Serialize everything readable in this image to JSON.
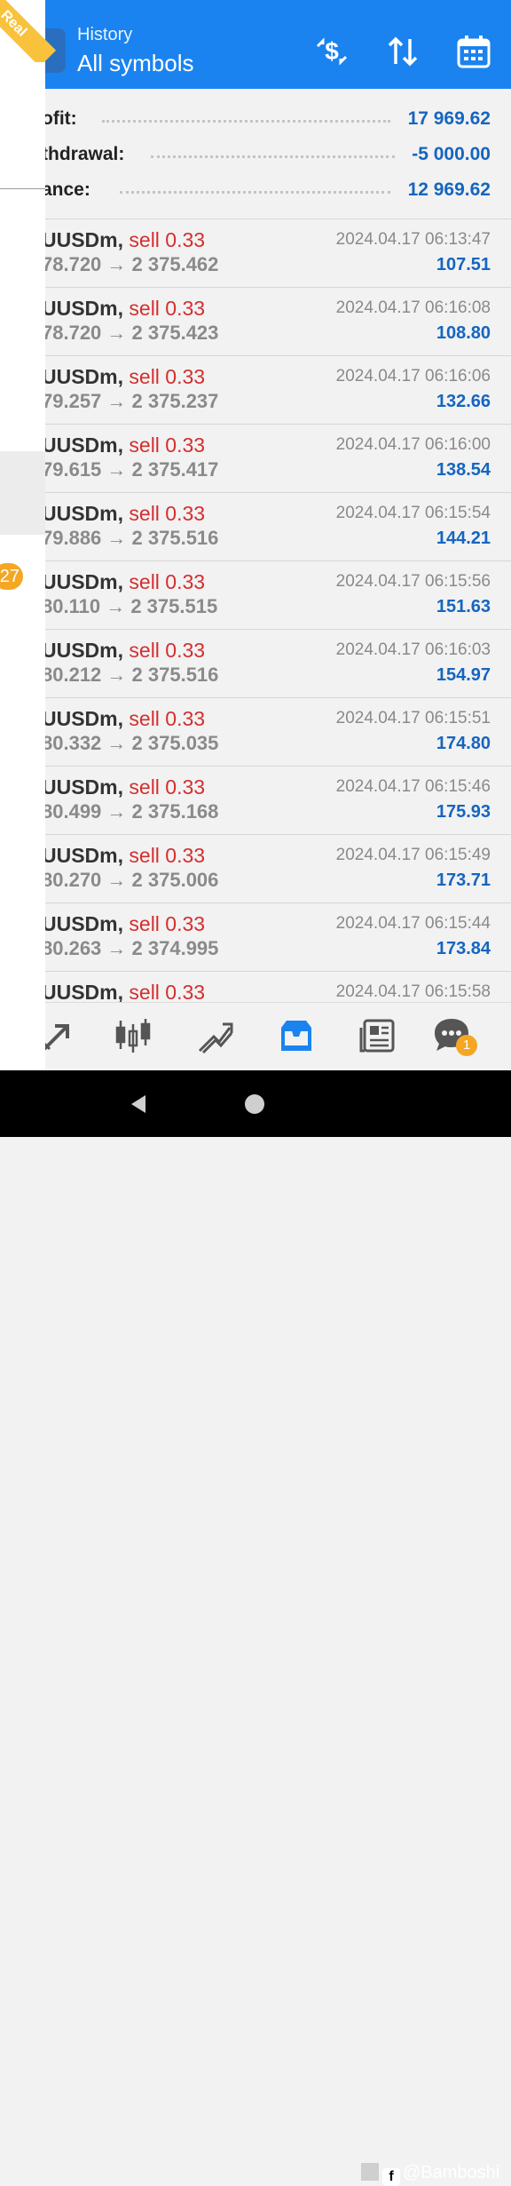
{
  "header": {
    "title_small": "History",
    "title_big": "All symbols",
    "icons": [
      "deposit-withdraw-icon",
      "sort-icon",
      "calendar-icon"
    ]
  },
  "account_badge": "Real",
  "summary": {
    "profit_label": "ofit:",
    "profit_value": "17 969.62",
    "withdrawal_label": "thdrawal:",
    "withdrawal_value": "-5 000.00",
    "balance_label": "ance:",
    "balance_value": "12 969.62"
  },
  "deals": [
    {
      "symbol": "UUSDm,",
      "side": "sell 0.33",
      "open": "78.720",
      "close": "2 375.462",
      "time": "2024.04.17 06:13:47",
      "profit": "107.51"
    },
    {
      "symbol": "UUSDm,",
      "side": "sell 0.33",
      "open": "78.720",
      "close": "2 375.423",
      "time": "2024.04.17 06:16:08",
      "profit": "108.80"
    },
    {
      "symbol": "UUSDm,",
      "side": "sell 0.33",
      "open": "79.257",
      "close": "2 375.237",
      "time": "2024.04.17 06:16:06",
      "profit": "132.66"
    },
    {
      "symbol": "UUSDm,",
      "side": "sell 0.33",
      "open": "79.615",
      "close": "2 375.417",
      "time": "2024.04.17 06:16:00",
      "profit": "138.54"
    },
    {
      "symbol": "UUSDm,",
      "side": "sell 0.33",
      "open": "79.886",
      "close": "2 375.516",
      "time": "2024.04.17 06:15:54",
      "profit": "144.21"
    },
    {
      "symbol": "UUSDm,",
      "side": "sell 0.33",
      "open": "80.110",
      "close": "2 375.515",
      "time": "2024.04.17 06:15:56",
      "profit": "151.63"
    },
    {
      "symbol": "UUSDm,",
      "side": "sell 0.33",
      "open": "80.212",
      "close": "2 375.516",
      "time": "2024.04.17 06:16:03",
      "profit": "154.97"
    },
    {
      "symbol": "UUSDm,",
      "side": "sell 0.33",
      "open": "80.332",
      "close": "2 375.035",
      "time": "2024.04.17 06:15:51",
      "profit": "174.80"
    },
    {
      "symbol": "UUSDm,",
      "side": "sell 0.33",
      "open": "80.499",
      "close": "2 375.168",
      "time": "2024.04.17 06:15:46",
      "profit": "175.93"
    },
    {
      "symbol": "UUSDm,",
      "side": "sell 0.33",
      "open": "80.270",
      "close": "2 375.006",
      "time": "2024.04.17 06:15:49",
      "profit": "173.71"
    },
    {
      "symbol": "UUSDm,",
      "side": "sell 0.33",
      "open": "80.263",
      "close": "2 374.995",
      "time": "2024.04.17 06:15:44",
      "profit": "173.84"
    },
    {
      "symbol": "UUSDm,",
      "side": "sell 0.33",
      "open": "",
      "close": "",
      "time": "2024.04.17 06:15:58",
      "profit": ""
    }
  ],
  "side_badge_count": "27",
  "tabbar": {
    "tabs": [
      "trade-icon",
      "chart-candles-icon",
      "trend-icon",
      "history-inbox-icon",
      "news-icon",
      "chat-icon"
    ],
    "active": "history-inbox-icon",
    "chat_badge": "1"
  },
  "watermark": "@Bamboshi",
  "colors": {
    "accent": "#1a83f0",
    "profit_blue": "#1565c0",
    "sell_red": "#d32f2f",
    "badge_orange": "#f5a623"
  }
}
